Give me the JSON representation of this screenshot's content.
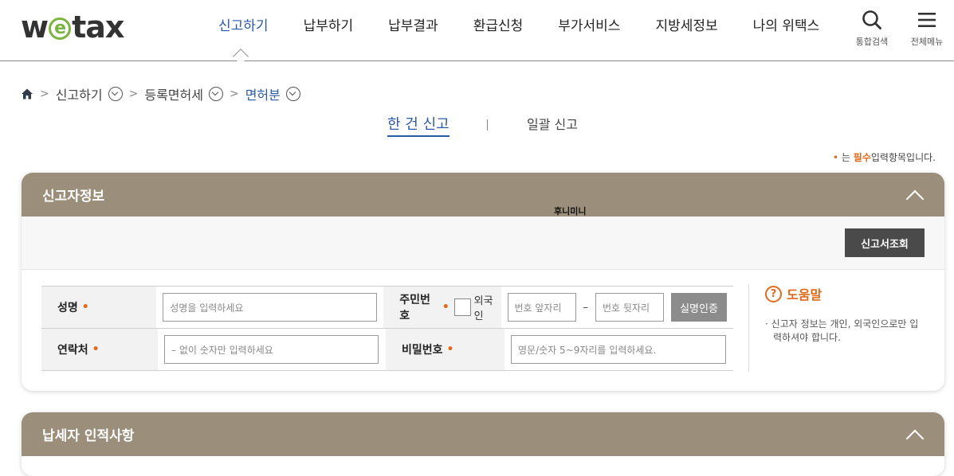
{
  "logo": {
    "pre": "w",
    "e": "e",
    "post": "tax"
  },
  "gnb": [
    {
      "label": "신고하기"
    },
    {
      "label": "납부하기"
    },
    {
      "label": "납부결과"
    },
    {
      "label": "환급신청"
    },
    {
      "label": "부가서비스"
    },
    {
      "label": "지방세정보"
    },
    {
      "label": "나의 위택스"
    }
  ],
  "utilities": {
    "search_label": "통합검색",
    "menu_label": "전체메뉴"
  },
  "breadcrumb": {
    "level1": "신고하기",
    "level2": "등록면허세",
    "level3": "면허분"
  },
  "tabs": {
    "single": "한 건 신고",
    "bulk": "일괄 신고"
  },
  "required_note": {
    "dot": "•",
    "pre": "는",
    "em": "필수",
    "post": "입력항목입니다."
  },
  "panel1": {
    "title": "신고자정보",
    "overlay_text": "후니미니",
    "lookup_button": "신고서조회",
    "form": {
      "name_label": "성명",
      "name_placeholder": "성명을 입력하세요",
      "rrn_label": "주민번호",
      "foreigner_label": "외국인",
      "rrn_front_placeholder": "번호 앞자리",
      "rrn_dash": "–",
      "rrn_back_placeholder": "번호 뒷자리",
      "verify_button": "실명인증",
      "contact_label": "연락처",
      "contact_placeholder": "– 없이 숫자만 입력하세요",
      "password_label": "비밀번호",
      "password_placeholder": "영문/숫자 5~9자리를 입력하세요.",
      "req_mark": "•"
    },
    "help": {
      "icon": "?",
      "title": "도움말",
      "text": "· 신고자 정보는 개인, 외국인으로만 입력하셔야 합니다."
    }
  },
  "panel2": {
    "title": "납세자 인적사항"
  }
}
